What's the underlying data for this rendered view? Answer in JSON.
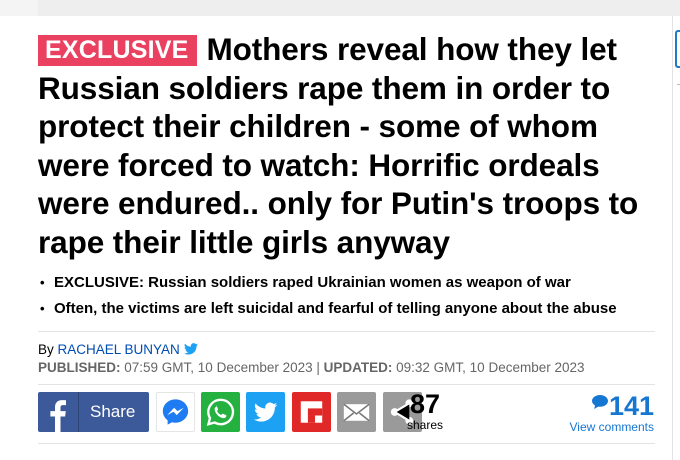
{
  "headline": {
    "badge": "EXCLUSIVE",
    "title": "Mothers reveal how they let Russian soldiers rape them in order to protect their children - some of whom were forced to watch: Horrific ordeals were endured.. only for Putin's troops to rape their little girls anyway"
  },
  "bullets": [
    {
      "lead": "EXCLUSIVE:",
      "text": " Russian soldiers raped Ukrainian women as weapon of war"
    },
    {
      "lead": "",
      "text": "Often, the victims are left suicidal and fearful of telling anyone about the abuse"
    }
  ],
  "byline": {
    "prefix": "By ",
    "author": "RACHAEL BUNYAN",
    "published_label": "PUBLISHED:",
    "published_value": " 07:59 GMT, 10 December 2023 | ",
    "updated_label": "UPDATED:",
    "updated_value": " 09:32 GMT, 10 December 2023"
  },
  "share": {
    "facebook_label": "Share",
    "buttons": [
      {
        "name": "messenger",
        "color": "#ffffff"
      },
      {
        "name": "whatsapp",
        "color": "#25b13f"
      },
      {
        "name": "twitter",
        "color": "#1da1f2"
      },
      {
        "name": "flipboard",
        "color": "#e12828"
      },
      {
        "name": "email",
        "color": "#9a9a9a"
      },
      {
        "name": "more-share",
        "color": "#9a9a9a"
      }
    ],
    "count": "87",
    "count_label": "shares"
  },
  "comments": {
    "count": "141",
    "label": "View comments"
  },
  "colors": {
    "badge": "#e9415f",
    "link": "#004db3",
    "facebook": "#3c5a99",
    "comments": "#1677d2"
  }
}
